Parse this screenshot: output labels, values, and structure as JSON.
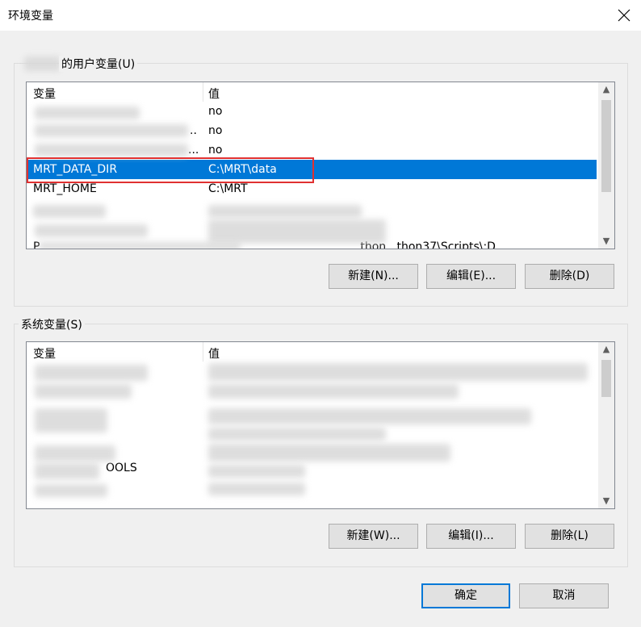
{
  "window": {
    "title": "环境变量"
  },
  "user_section": {
    "title": "的用户变量(U)",
    "columns": [
      "变量",
      "值"
    ],
    "rows": [
      {
        "name": "",
        "value": "no"
      },
      {
        "name": "..",
        "value": "no"
      },
      {
        "name": "...",
        "value": "no"
      },
      {
        "name": "MRT_DATA_DIR",
        "value": "C:\\MRT\\data",
        "selected": true
      },
      {
        "name": "MRT_HOME",
        "value": "C:\\MRT"
      },
      {
        "name": "",
        "value": ""
      },
      {
        "name": "",
        "value": ""
      },
      {
        "name": "P",
        "value": "...thon...thon37\\Scripts\\;D..."
      }
    ],
    "buttons": {
      "new": "新建(N)...",
      "edit": "编辑(E)...",
      "delete": "删除(D)"
    }
  },
  "system_section": {
    "title": "系统变量(S)",
    "columns": [
      "变量",
      "值"
    ],
    "rows": [
      {
        "name": "",
        "value": ""
      },
      {
        "name": "",
        "value": ""
      },
      {
        "name": "",
        "value": ""
      },
      {
        "name": "",
        "value": ""
      },
      {
        "name": "",
        "value": ""
      },
      {
        "name": "OOLS",
        "value": ""
      },
      {
        "name": "",
        "value": ""
      }
    ],
    "buttons": {
      "new": "新建(W)...",
      "edit": "编辑(I)...",
      "delete": "删除(L)"
    }
  },
  "footer": {
    "ok": "确定",
    "cancel": "取消"
  },
  "colors": {
    "selection": "#0078d7",
    "annotation_box": "#e03131",
    "default_button_border": "#0078d7"
  }
}
